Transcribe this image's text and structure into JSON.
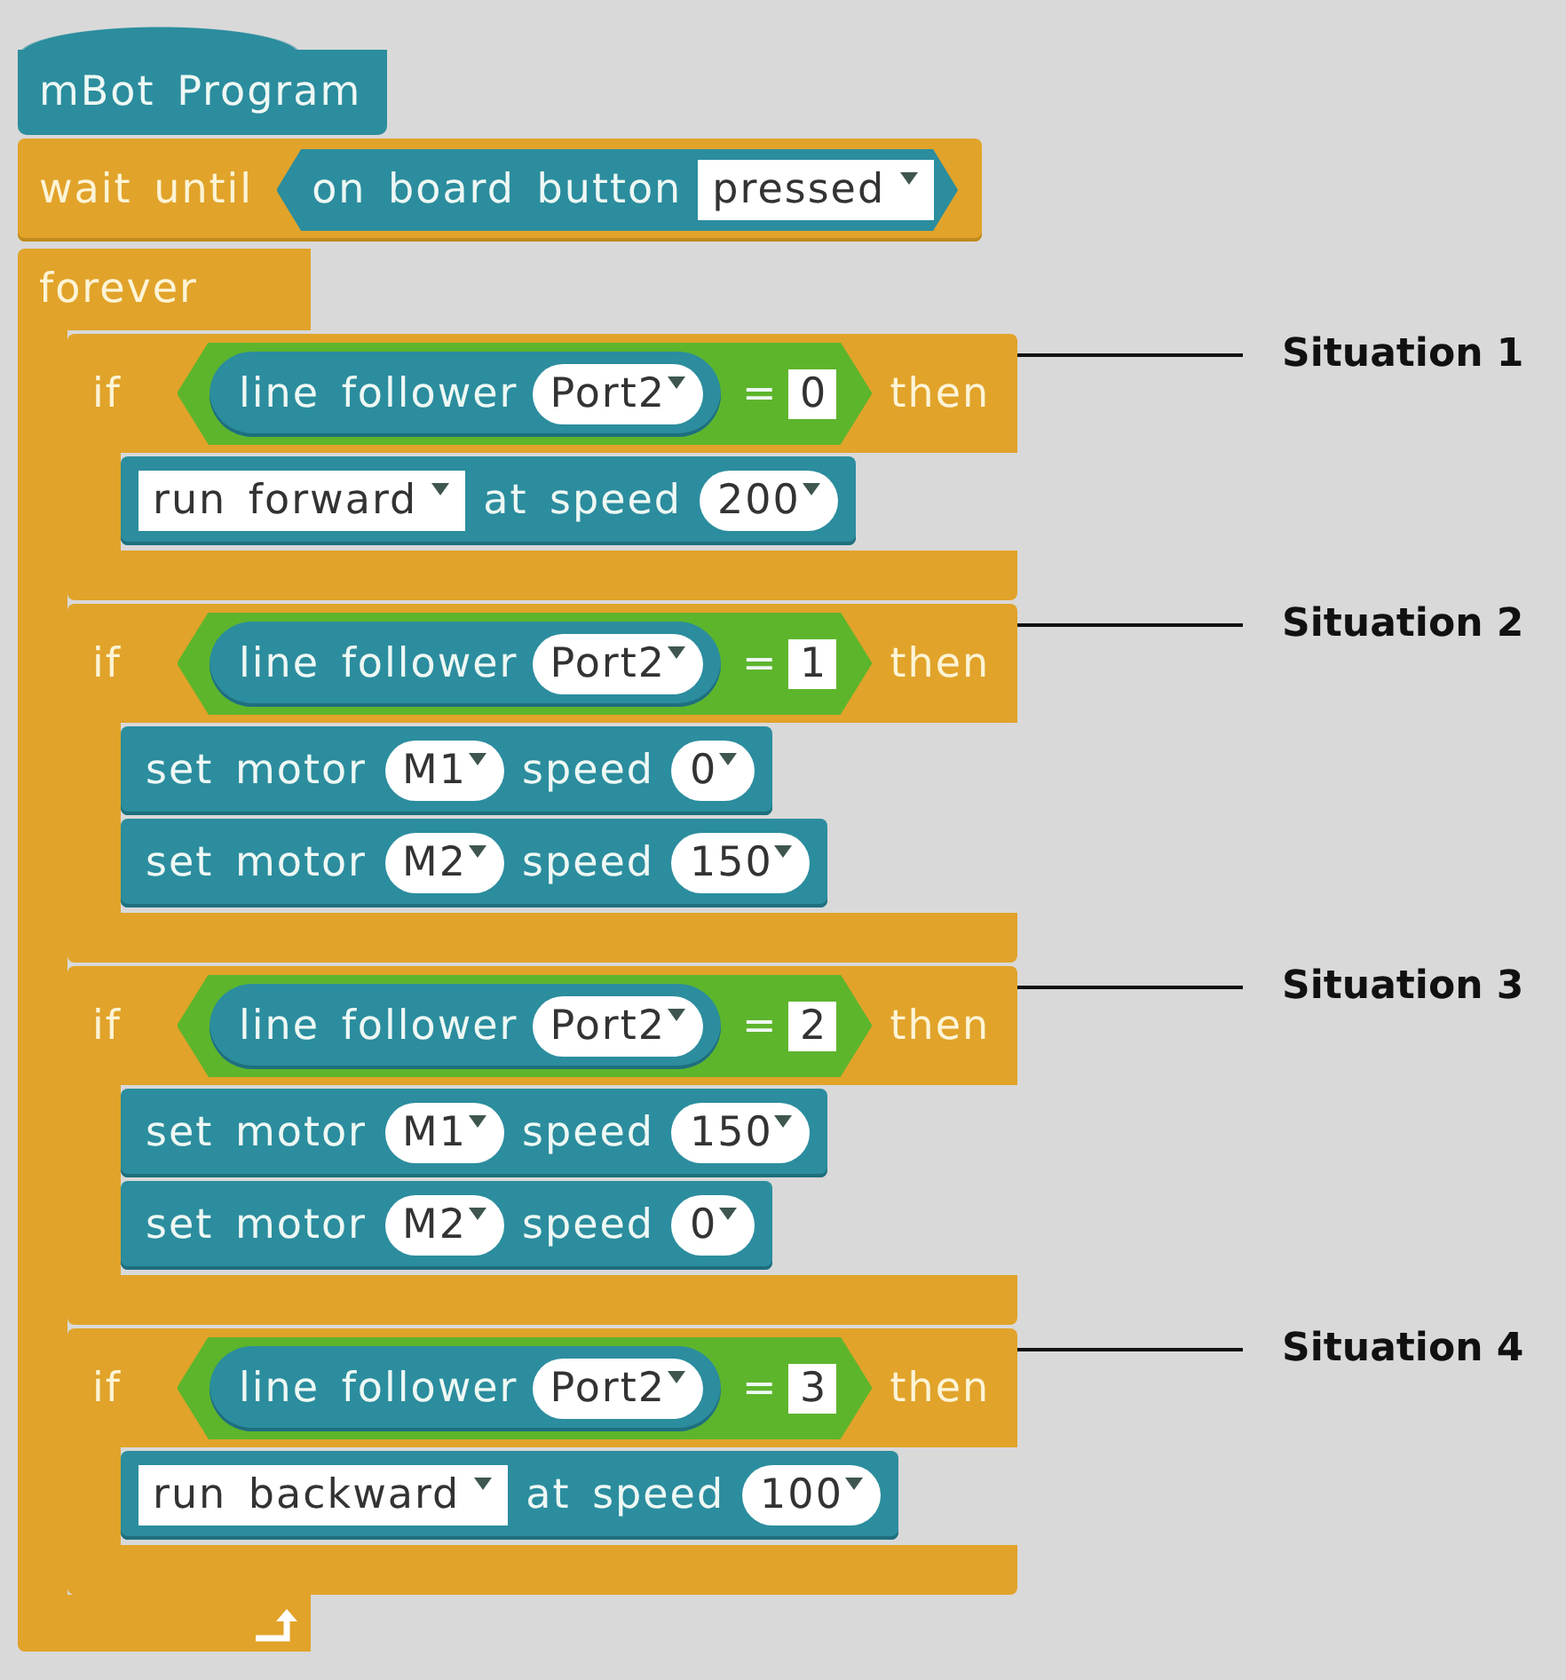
{
  "hat_block": {
    "label": "mBot Program"
  },
  "wait_block": {
    "label": "wait until",
    "condition": {
      "label": "on board button",
      "dropdown": "pressed"
    }
  },
  "forever_block": {
    "label": "forever",
    "if_blocks": [
      {
        "label": "if",
        "condition": {
          "sensor": "line follower",
          "port": "Port2",
          "operator": "=",
          "value": "0"
        },
        "then_label": "then",
        "body": [
          {
            "kind": "run",
            "direction": "run forward",
            "label": "at speed",
            "speed": "200"
          }
        ],
        "annotation": "Situation 1"
      },
      {
        "label": "if",
        "condition": {
          "sensor": "line follower",
          "port": "Port2",
          "operator": "=",
          "value": "1"
        },
        "then_label": "then",
        "body": [
          {
            "kind": "set_motor",
            "label": "set motor",
            "motor": "M1",
            "speed_label": "speed",
            "speed": "0"
          },
          {
            "kind": "set_motor",
            "label": "set motor",
            "motor": "M2",
            "speed_label": "speed",
            "speed": "150"
          }
        ],
        "annotation": "Situation 2"
      },
      {
        "label": "if",
        "condition": {
          "sensor": "line follower",
          "port": "Port2",
          "operator": "=",
          "value": "2"
        },
        "then_label": "then",
        "body": [
          {
            "kind": "set_motor",
            "label": "set motor",
            "motor": "M1",
            "speed_label": "speed",
            "speed": "150"
          },
          {
            "kind": "set_motor",
            "label": "set motor",
            "motor": "M2",
            "speed_label": "speed",
            "speed": "0"
          }
        ],
        "annotation": "Situation 3"
      },
      {
        "label": "if",
        "condition": {
          "sensor": "line follower",
          "port": "Port2",
          "operator": "=",
          "value": "3"
        },
        "then_label": "then",
        "body": [
          {
            "kind": "run",
            "direction": "run backward",
            "label": "at speed",
            "speed": "100"
          }
        ],
        "annotation": "Situation 4"
      }
    ]
  }
}
